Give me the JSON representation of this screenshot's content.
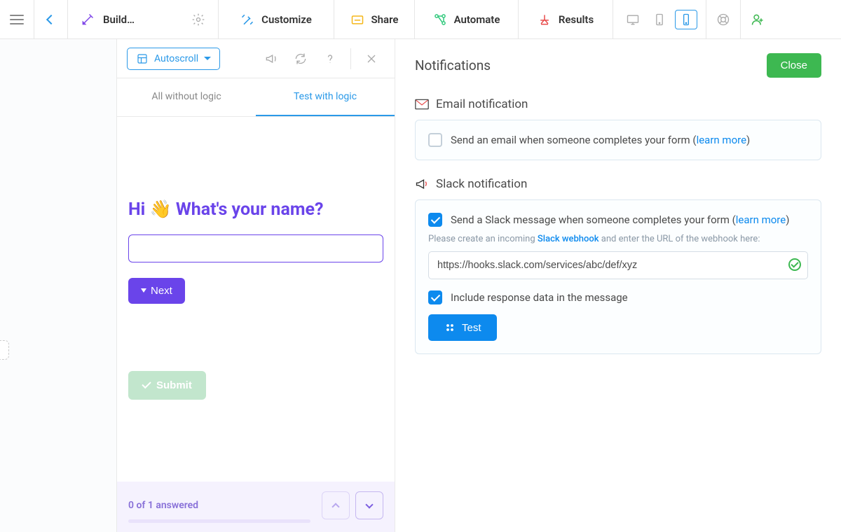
{
  "topnav": {
    "build": "Build…",
    "customize": "Customize",
    "share": "Share",
    "automate": "Automate",
    "results": "Results"
  },
  "preview": {
    "autoscroll": "Autoscroll",
    "tabs": {
      "all": "All without logic",
      "test": "Test with logic"
    },
    "question": "Hi 👋 What's your name?",
    "next": "Next",
    "submit": "Submit",
    "progress": "0 of 1 answered"
  },
  "panel": {
    "title": "Notifications",
    "close": "Close",
    "email": {
      "title": "Email notification",
      "label_pre": "Send an email when someone completes your form (",
      "learn": "learn more",
      "label_post": ")"
    },
    "slack": {
      "title": "Slack notification",
      "label_pre": "Send a Slack message when someone completes your form (",
      "learn": "learn more",
      "label_post": ")",
      "help_pre": "Please create an incoming ",
      "help_link": "Slack webhook",
      "help_post": " and enter the URL of the webhook here:",
      "webhook_value": "https://hooks.slack.com/services/abc/def/xyz",
      "include": "Include response data in the message",
      "test": "Test"
    }
  }
}
